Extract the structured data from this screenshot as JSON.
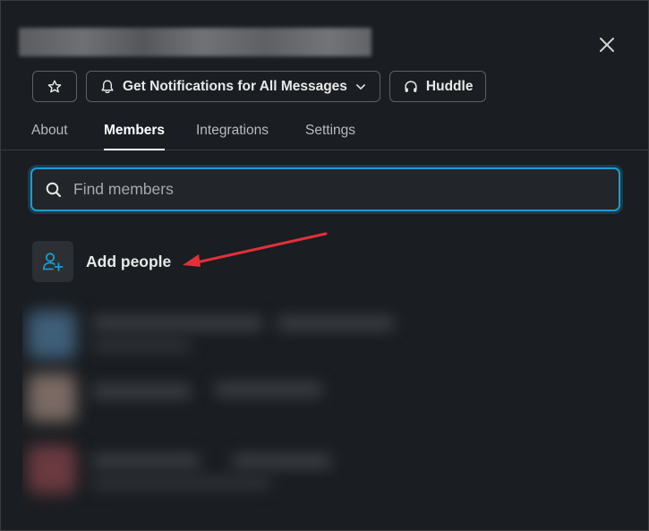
{
  "header": {
    "close_label": "×"
  },
  "actions": {
    "star": {
      "icon": "star-icon"
    },
    "notifications": {
      "label": "Get Notifications for All Messages",
      "icon": "bell-icon",
      "dropdown_icon": "chevron-down-icon"
    },
    "huddle": {
      "label": "Huddle",
      "icon": "headphones-icon"
    }
  },
  "tabs": [
    {
      "label": "About",
      "active": false
    },
    {
      "label": "Members",
      "active": true
    },
    {
      "label": "Integrations",
      "active": false
    },
    {
      "label": "Settings",
      "active": false
    }
  ],
  "search": {
    "placeholder": "Find members",
    "value": ""
  },
  "add_people": {
    "label": "Add people",
    "icon": "add-user-icon"
  },
  "colors": {
    "background": "#1a1d21",
    "accent": "#1d9bd1",
    "annotation_arrow": "#e0313a"
  }
}
